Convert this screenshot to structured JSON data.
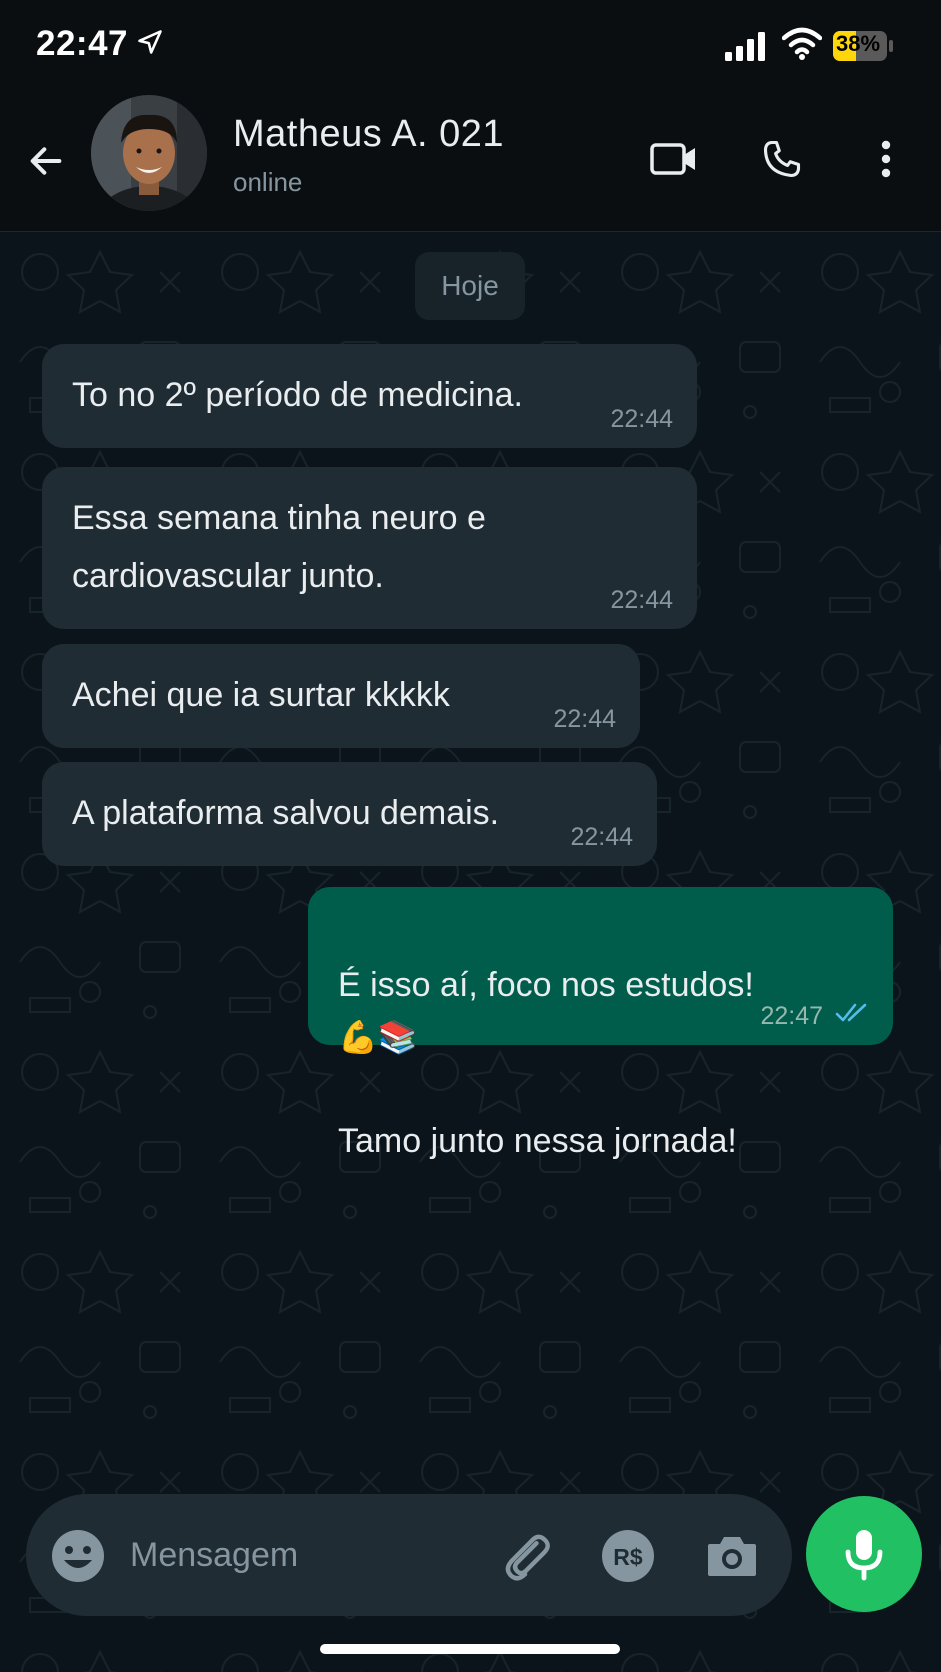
{
  "status_bar": {
    "time": "22:47",
    "battery": "38%"
  },
  "header": {
    "contact_name": "Matheus A. 021",
    "contact_status": "online",
    "icons": [
      "back-arrow-icon",
      "video-call-icon",
      "phone-icon",
      "more-vert-icon"
    ]
  },
  "chat": {
    "date_chip": "Hoje",
    "messages": [
      {
        "direction": "in",
        "text": "To no 2º período de medicina.",
        "time": "22:44"
      },
      {
        "direction": "in",
        "text": "Essa semana tinha neuro e\ncardiovascular junto.",
        "time": "22:44"
      },
      {
        "direction": "in",
        "text": "Achei que ia surtar kkkkk",
        "time": "22:44"
      },
      {
        "direction": "in",
        "text": "A plataforma salvou demais.",
        "time": "22:44"
      },
      {
        "direction": "out",
        "line1": "É isso aí, foco nos estudos!",
        "emojis": "💪📚",
        "line2": "Tamo junto nessa jornada!",
        "time": "22:47",
        "status": "read"
      }
    ]
  },
  "composer": {
    "placeholder": "Mensagem",
    "payment_label": "R$"
  },
  "colors": {
    "incoming_bubble": "#202c33",
    "outgoing_bubble": "#005c4b",
    "accent": "#21c063",
    "read_tick": "#53bdeb"
  }
}
